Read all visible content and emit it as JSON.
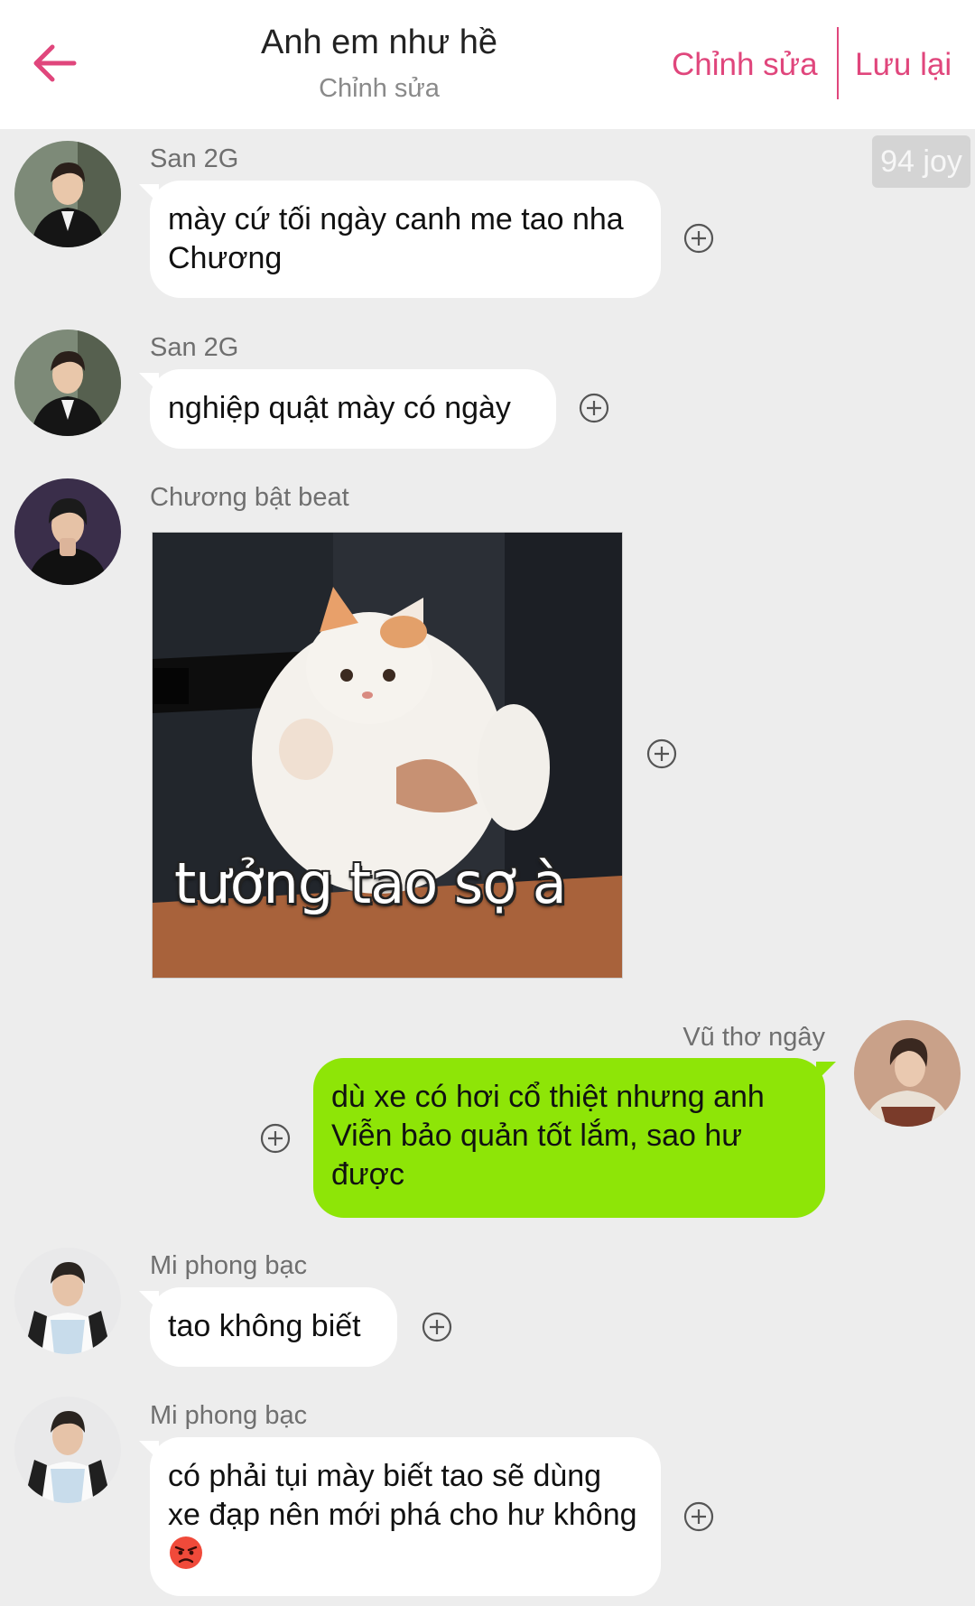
{
  "header": {
    "title": "Anh em như hề",
    "subtitle": "Chỉnh sửa",
    "edit_label": "Chỉnh sửa",
    "save_label": "Lưu lại",
    "accent_color": "#e0467c"
  },
  "joy_badge": "94 joy",
  "messages": [
    {
      "sender": "San 2G",
      "text": "mày cứ tối ngày canh me tao nha Chương",
      "side": "left"
    },
    {
      "sender": "San 2G",
      "text": "nghiệp quật mày có ngày",
      "side": "left"
    },
    {
      "sender": "Chương bật beat",
      "type": "sticker",
      "caption": "tưởng tao sợ à",
      "side": "left"
    },
    {
      "sender": "Vũ thơ ngây",
      "text": "dù xe có hơi cổ thiệt nhưng anh Viễn bảo quản tốt lắm, sao hư được",
      "side": "right"
    },
    {
      "sender": "Mi phong bạc",
      "text": "tao không biết",
      "side": "left"
    },
    {
      "sender": "Mi phong bạc",
      "text": "có phải tụi mày biết tao sẽ dùng xe đạp nên mới phá cho hư không",
      "emoji": "angry-face",
      "side": "left"
    }
  ],
  "colors": {
    "background": "#ededed",
    "my_bubble": "#8ee507",
    "other_bubble": "#ffffff"
  }
}
